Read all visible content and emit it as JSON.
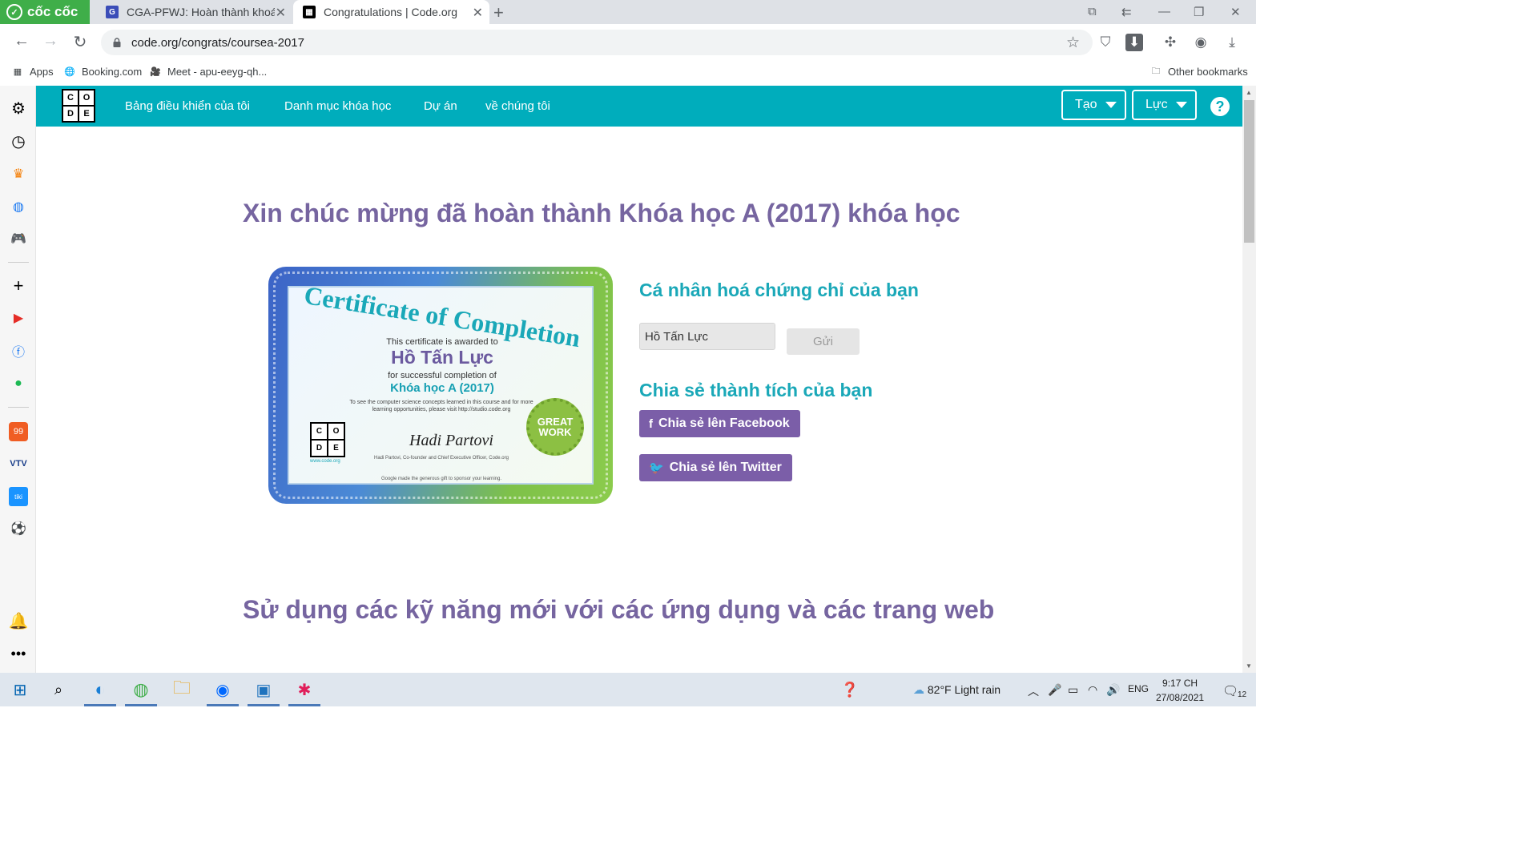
{
  "browser": {
    "brand": "cốc cốc",
    "tabs": [
      {
        "title": "CGA-PFWJ: Hoàn thành khoá",
        "active": false
      },
      {
        "title": "Congratulations | Code.org",
        "active": true
      }
    ],
    "url": "code.org/congrats/coursea-2017",
    "bookmarks": [
      "Apps",
      "Booking.com",
      "Meet - apu-eeyg-qh...",
      "Other bookmarks"
    ]
  },
  "header": {
    "logo_letters": [
      "C",
      "O",
      "D",
      "E"
    ],
    "nav": [
      "Bảng điều khiển của tôi",
      "Danh mục khóa học",
      "Dự án",
      "về chúng tôi"
    ],
    "create_label": "Tạo",
    "user_label": "Lực",
    "help_label": "?"
  },
  "main": {
    "title": "Xin chúc mừng đã hoàn thành Khóa học A (2017) khóa học",
    "personalize_heading": "Cá nhân hoá chứng chỉ của bạn",
    "name_value": "Hồ Tấn Lực",
    "submit_label": "Gửi",
    "share_heading": "Chia sẻ thành tích của bạn",
    "share_facebook": "Chia sẻ lên Facebook",
    "share_twitter": "Chia sẻ lên Twitter",
    "section2_title": "Sử dụng các kỹ năng mới với các ứng dụng và các trang web"
  },
  "certificate": {
    "title": "Certificate of Completion",
    "awarded": "This certificate is awarded to",
    "name": "Hồ Tấn Lực",
    "for": "for successful completion of",
    "course": "Khóa học A (2017)",
    "small_text": "To see the computer science concepts learned in this course and for more learning opportunities, please visit http://studio.code.org",
    "signature": "Hadi Partovi",
    "signature_caption": "Hadi Partovi, Co-founder and Chief Executive Officer, Code.org",
    "footer": "Google made the generous gift to sponsor your learning.",
    "badge_line1": "GREAT",
    "badge_line2": "WORK",
    "logo_url": "www.code.org"
  },
  "taskbar": {
    "weather": "82°F  Light rain",
    "lang": "ENG",
    "time": "9:17 CH",
    "date": "27/08/2021",
    "notif_count": "12"
  },
  "colors": {
    "header_bg": "#00adbc",
    "title_purple": "#7665a0",
    "heading_teal": "#1aa8b8",
    "share_purple": "#7b5ea8"
  }
}
